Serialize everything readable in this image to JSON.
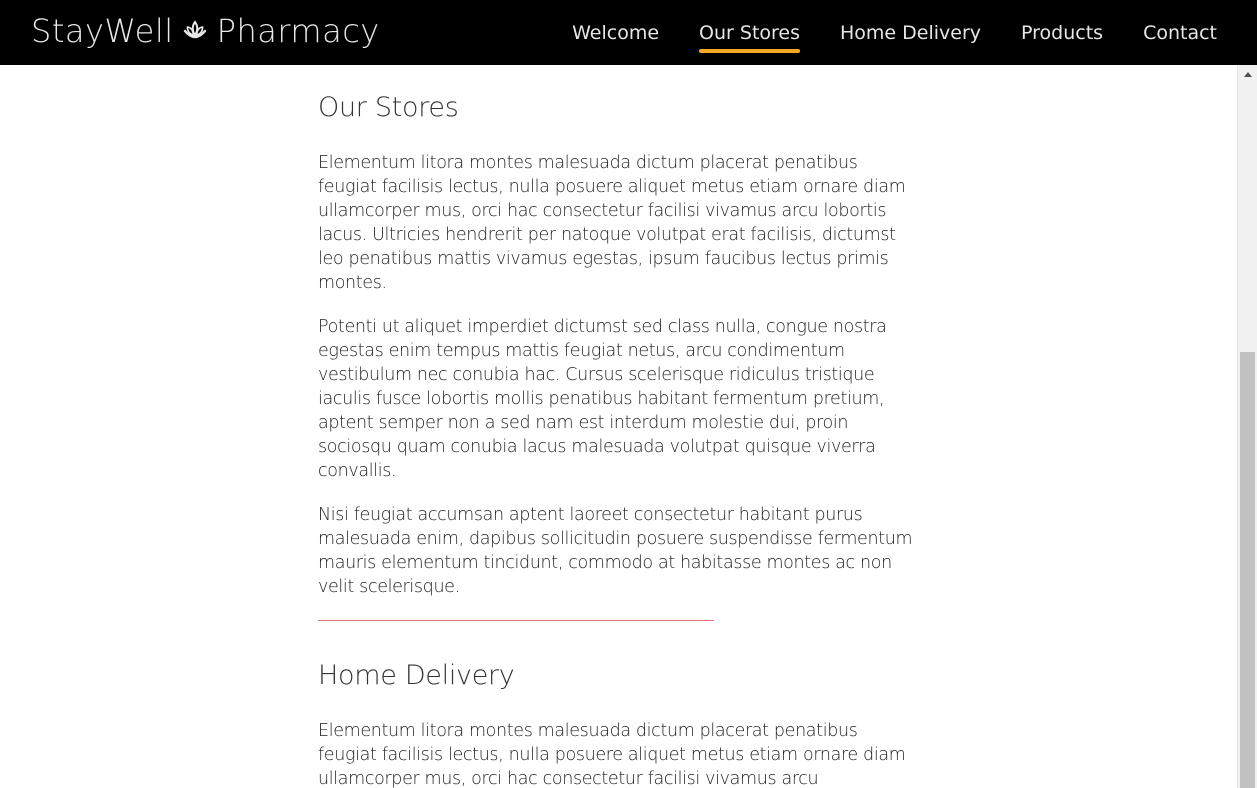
{
  "brand": {
    "name_part1": "StayWell",
    "name_part2": "Pharmacy",
    "logo_icon": "leaf-bowl-icon"
  },
  "nav": {
    "items": [
      {
        "label": "Welcome",
        "active": false
      },
      {
        "label": "Our Stores",
        "active": true
      },
      {
        "label": "Home Delivery",
        "active": false
      },
      {
        "label": "Products",
        "active": false
      },
      {
        "label": "Contact",
        "active": false
      }
    ],
    "active_color": "#f5a623"
  },
  "sections": [
    {
      "title": "Our Stores",
      "paragraphs": [
        "Elementum litora montes malesuada dictum placerat penatibus feugiat facilisis lectus, nulla posuere aliquet metus etiam ornare diam ullamcorper mus, orci hac consectetur facilisi vivamus arcu lobortis lacus. Ultricies hendrerit per natoque volutpat erat facilisis, dictumst leo penatibus mattis vivamus egestas, ipsum faucibus lectus primis montes.",
        "Potenti ut aliquet imperdiet dictumst sed class nulla, congue nostra egestas enim tempus mattis feugiat netus, arcu condimentum vestibulum nec conubia hac. Cursus scelerisque ridiculus tristique iaculis fusce lobortis mollis penatibus habitant fermentum pretium, aptent semper non a sed nam est interdum molestie dui, proin sociosqu quam conubia lacus malesuada volutpat quisque viverra convallis.",
        "Nisi feugiat accumsan aptent laoreet consectetur habitant purus malesuada enim, dapibus sollicitudin posuere suspendisse fermentum mauris elementum tincidunt, commodo at habitasse montes ac non velit scelerisque."
      ]
    },
    {
      "title": "Home Delivery",
      "paragraphs": [
        "Elementum litora montes malesuada dictum placerat penatibus feugiat facilisis lectus, nulla posuere aliquet metus etiam ornare diam ullamcorper mus, orci hac consectetur facilisi vivamus arcu"
      ]
    }
  ],
  "divider_color": "#e57373"
}
